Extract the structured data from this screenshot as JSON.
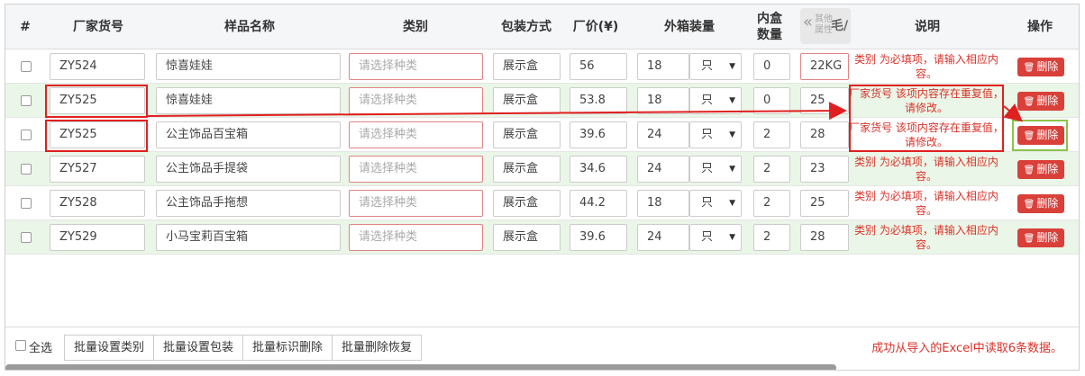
{
  "columns": {
    "num": "#",
    "sku": "厂家货号",
    "name": "样品名称",
    "category": "类别",
    "packaging": "包装方式",
    "price": "厂价(¥)",
    "outer_qty": "外箱装量",
    "inner_qty_line1": "内盒",
    "inner_qty_line2": "数量",
    "other_attrs": "其他属性",
    "other_attrs_partial": "毛/",
    "note": "说明",
    "ops": "操作"
  },
  "category_placeholder": "请选择种类",
  "delete_label": "删除",
  "rows": [
    {
      "sku": "ZY524",
      "name": "惊喜娃娃",
      "packaging": "展示盒",
      "price": "56",
      "outer_qty": "18",
      "unit": "只",
      "inner_qty": "0",
      "weight": "22KG",
      "note": "类别 为必填项，请输入相应内容。"
    },
    {
      "sku": "ZY525",
      "name": "惊喜娃娃",
      "packaging": "展示盒",
      "price": "53.8",
      "outer_qty": "18",
      "unit": "只",
      "inner_qty": "0",
      "weight": "25",
      "note": "厂家货号 该项内容存在重复值，请修改。"
    },
    {
      "sku": "ZY525",
      "name": "公主饰品百宝箱",
      "packaging": "展示盒",
      "price": "39.6",
      "outer_qty": "24",
      "unit": "只",
      "inner_qty": "2",
      "weight": "28",
      "note": "厂家货号 该项内容存在重复值，请修改。"
    },
    {
      "sku": "ZY527",
      "name": "公主饰品手提袋",
      "packaging": "展示盒",
      "price": "34.6",
      "outer_qty": "24",
      "unit": "只",
      "inner_qty": "2",
      "weight": "23",
      "note": "类别 为必填项，请输入相应内容。"
    },
    {
      "sku": "ZY528",
      "name": "公主饰品手拖想",
      "packaging": "展示盒",
      "price": "44.2",
      "outer_qty": "18",
      "unit": "只",
      "inner_qty": "2",
      "weight": "25",
      "note": "类别 为必填项，请输入相应内容。"
    },
    {
      "sku": "ZY529",
      "name": "小马宝莉百宝箱",
      "packaging": "展示盒",
      "price": "39.6",
      "outer_qty": "24",
      "unit": "只",
      "inner_qty": "2",
      "weight": "28",
      "note": "类别 为必填项，请输入相应内容。"
    }
  ],
  "footer": {
    "select_all": "全选",
    "btn_set_category": "批量设置类别",
    "btn_set_packaging": "批量设置包装",
    "btn_mark_delete": "批量标识删除",
    "btn_restore": "批量删除恢复",
    "status": "成功从导入的Excel中读取6条数据。"
  },
  "colors": {
    "error_text": "#d9332b",
    "delete_button": "#d9403a",
    "highlight_red": "#e02020",
    "highlight_green": "#8bc34a",
    "row_alt_bg": "#eaf6e7"
  }
}
